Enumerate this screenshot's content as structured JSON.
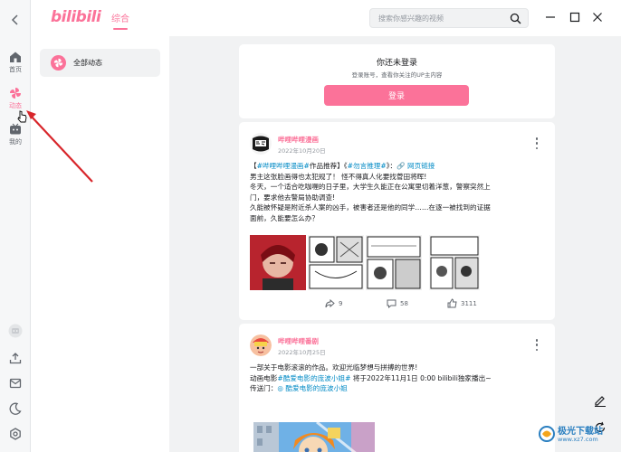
{
  "app": {
    "logo_text": "bilibili",
    "brand_color": "#fb7299"
  },
  "header": {
    "tab_main": "综合",
    "search_placeholder": "搜索你感兴趣的视频"
  },
  "rail": {
    "items": [
      {
        "label": "首页",
        "icon": "home-icon"
      },
      {
        "label": "动态",
        "icon": "pinwheel-icon",
        "active": true
      },
      {
        "label": "我的",
        "icon": "tv-icon"
      }
    ],
    "bottom_icons": [
      "avatar-placeholder-icon",
      "upload-icon",
      "mail-icon",
      "moon-icon",
      "settings-icon"
    ]
  },
  "left_panel": {
    "all_dynamics_label": "全部动态"
  },
  "login_card": {
    "title": "你还未登录",
    "subtitle": "登录账号，查看你关注的UP主内容",
    "button_label": "登录"
  },
  "posts": [
    {
      "author": "哔哩哔哩漫画",
      "date": "2022年10月20日",
      "lines": [
        {
          "parts": [
            {
              "text": "【",
              "style": ""
            },
            {
              "text": "#哔哩哔哩漫画#",
              "style": "blue"
            },
            {
              "text": "作品推荐】《",
              "style": ""
            },
            {
              "text": "#勿言推理#",
              "style": "blue"
            },
            {
              "text": "》：",
              "style": ""
            },
            {
              "text": "🔗 网页链接",
              "style": "blue"
            }
          ]
        },
        {
          "parts": [
            {
              "text": "男主这张脸画得也太犯规了！ 怪不得真人化要找菅田将晖!",
              "style": ""
            }
          ]
        },
        {
          "parts": [
            {
              "text": "冬天，一个适合吃咖喱的日子里，大学生久能正在公寓里切着洋葱，警察突然上",
              "style": ""
            }
          ]
        },
        {
          "parts": [
            {
              "text": "门，要求他去警局协助调查!",
              "style": ""
            }
          ]
        },
        {
          "parts": [
            {
              "text": "久能被怀疑是附近杀人案的凶手，被害者还是他的同学……在逐一被找到的证据",
              "style": ""
            }
          ]
        },
        {
          "parts": [
            {
              "text": "面前，久能要怎么办？",
              "style": ""
            }
          ]
        }
      ],
      "stats": {
        "forward": "9",
        "comment": "58",
        "like": "3111"
      }
    },
    {
      "author": "哔哩哔哩番剧",
      "date": "2022年10月25日",
      "lines": [
        {
          "parts": [
            {
              "text": "一部关于电影滚滚的作品。欢迎光临梦想与拼搏的世界!",
              "style": ""
            }
          ]
        },
        {
          "parts": [
            {
              "text": "动画电影",
              "style": ""
            },
            {
              "text": "#酷爱电影的庞波小姐#",
              "style": "blue"
            },
            {
              "text": " 将于2022年11月1日 0:00 bilibili独家播出~",
              "style": ""
            }
          ]
        },
        {
          "parts": [
            {
              "text": "传送门：",
              "style": ""
            },
            {
              "text": "◎ 酷爱电影的庞波小姐",
              "style": "blue"
            }
          ]
        }
      ]
    }
  ],
  "watermark": {
    "text": "极光下载站",
    "url": "www.xz7.com"
  }
}
